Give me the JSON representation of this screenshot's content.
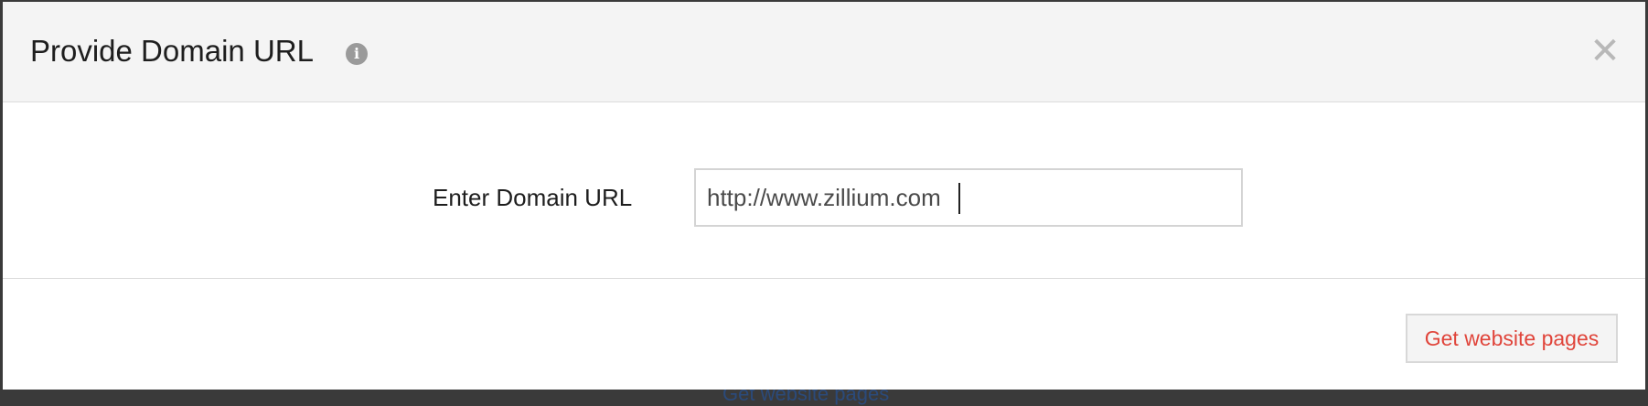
{
  "backdrop": {
    "link_label": "Get website pages"
  },
  "modal": {
    "title": "Provide Domain URL",
    "info_icon": "info-icon",
    "info_glyph": "i",
    "close_icon": "close-icon",
    "close_glyph": "✕"
  },
  "form": {
    "label": "Enter Domain URL",
    "url_value": "http://www.zillium.com"
  },
  "footer": {
    "submit_label": "Get website pages"
  },
  "colors": {
    "header_bg": "#f4f4f4",
    "accent_text": "#e0443a",
    "border": "#d4d4d4"
  }
}
